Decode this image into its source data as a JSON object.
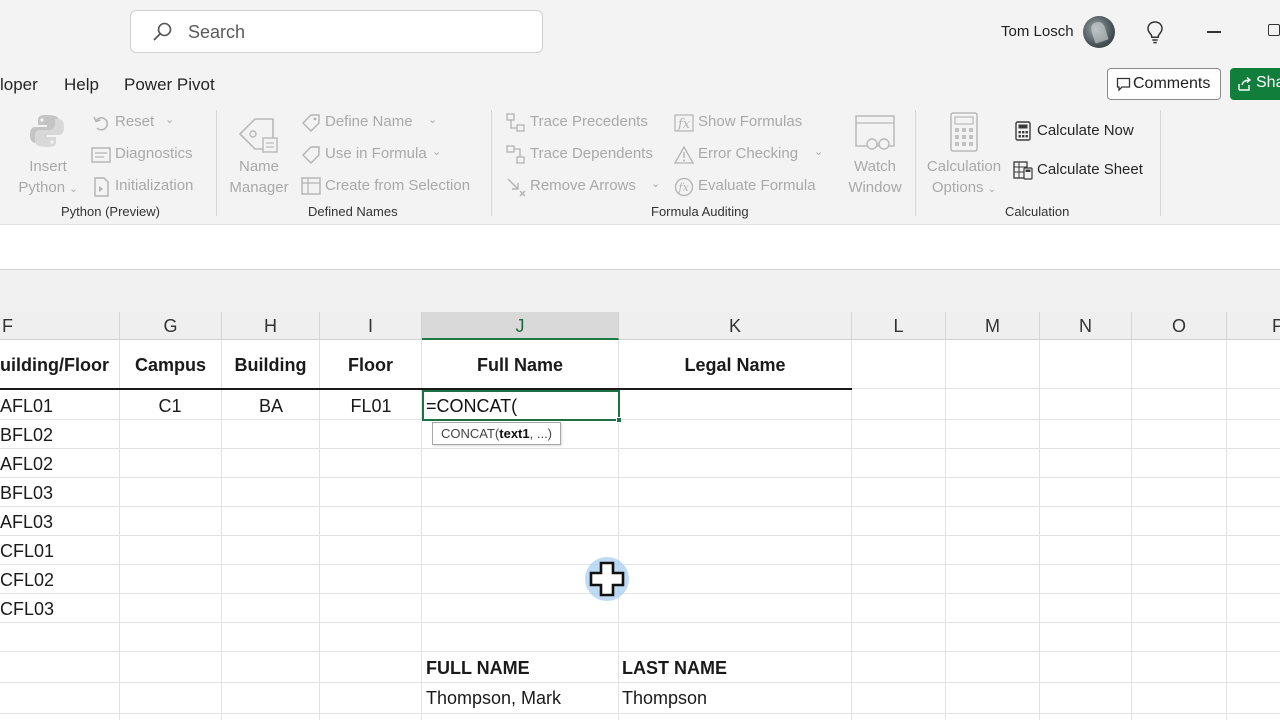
{
  "header": {
    "search_placeholder": "Search",
    "user_name": "Tom Losch"
  },
  "menu": {
    "tabs": [
      "loper",
      "Help",
      "Power Pivot"
    ],
    "comments_label": "Comments",
    "share_label": "Sha"
  },
  "ribbon": {
    "python": {
      "insert_line1": "Insert",
      "insert_line2": "Python",
      "reset": "Reset",
      "diagnostics": "Diagnostics",
      "initialization": "Initialization",
      "title": "Python (Preview)"
    },
    "defined_names": {
      "name_manager_line1": "Name",
      "name_manager_line2": "Manager",
      "define_name": "Define Name",
      "use_in_formula": "Use in Formula",
      "create_from_selection": "Create from Selection",
      "title": "Defined Names"
    },
    "formula_auditing": {
      "trace_precedents": "Trace Precedents",
      "trace_dependents": "Trace Dependents",
      "remove_arrows": "Remove Arrows",
      "show_formulas": "Show Formulas",
      "error_checking": "Error Checking",
      "evaluate_formula": "Evaluate Formula",
      "watch_window_line1": "Watch",
      "watch_window_line2": "Window",
      "title": "Formula Auditing"
    },
    "calculation": {
      "options_line1": "Calculation",
      "options_line2": "Options",
      "calculate_now": "Calculate Now",
      "calculate_sheet": "Calculate Sheet",
      "title": "Calculation"
    }
  },
  "sheet": {
    "columns": [
      "F",
      "G",
      "H",
      "I",
      "J",
      "K",
      "L",
      "M",
      "N",
      "O",
      "P"
    ],
    "headers": {
      "building_floor": "uilding/Floor",
      "campus": "Campus",
      "building": "Building",
      "floor": "Floor",
      "full_name": "Full Name",
      "legal_name": "Legal Name"
    },
    "first_row": {
      "campus": "C1",
      "building": "BA",
      "floor": "FL01"
    },
    "f_values": [
      "AFL01",
      "BFL02",
      "AFL02",
      "BFL03",
      "AFL03",
      "CFL01",
      "CFL02",
      "CFL03"
    ],
    "active_cell_formula": "=CONCAT(",
    "tooltip": {
      "func": "CONCAT(",
      "arg": "text1",
      "rest": ", ...)"
    },
    "lower_table": {
      "header_full": "FULL NAME",
      "header_last": "LAST NAME",
      "row1_full": "Thompson, Mark",
      "row1_last": "Thompson"
    }
  }
}
